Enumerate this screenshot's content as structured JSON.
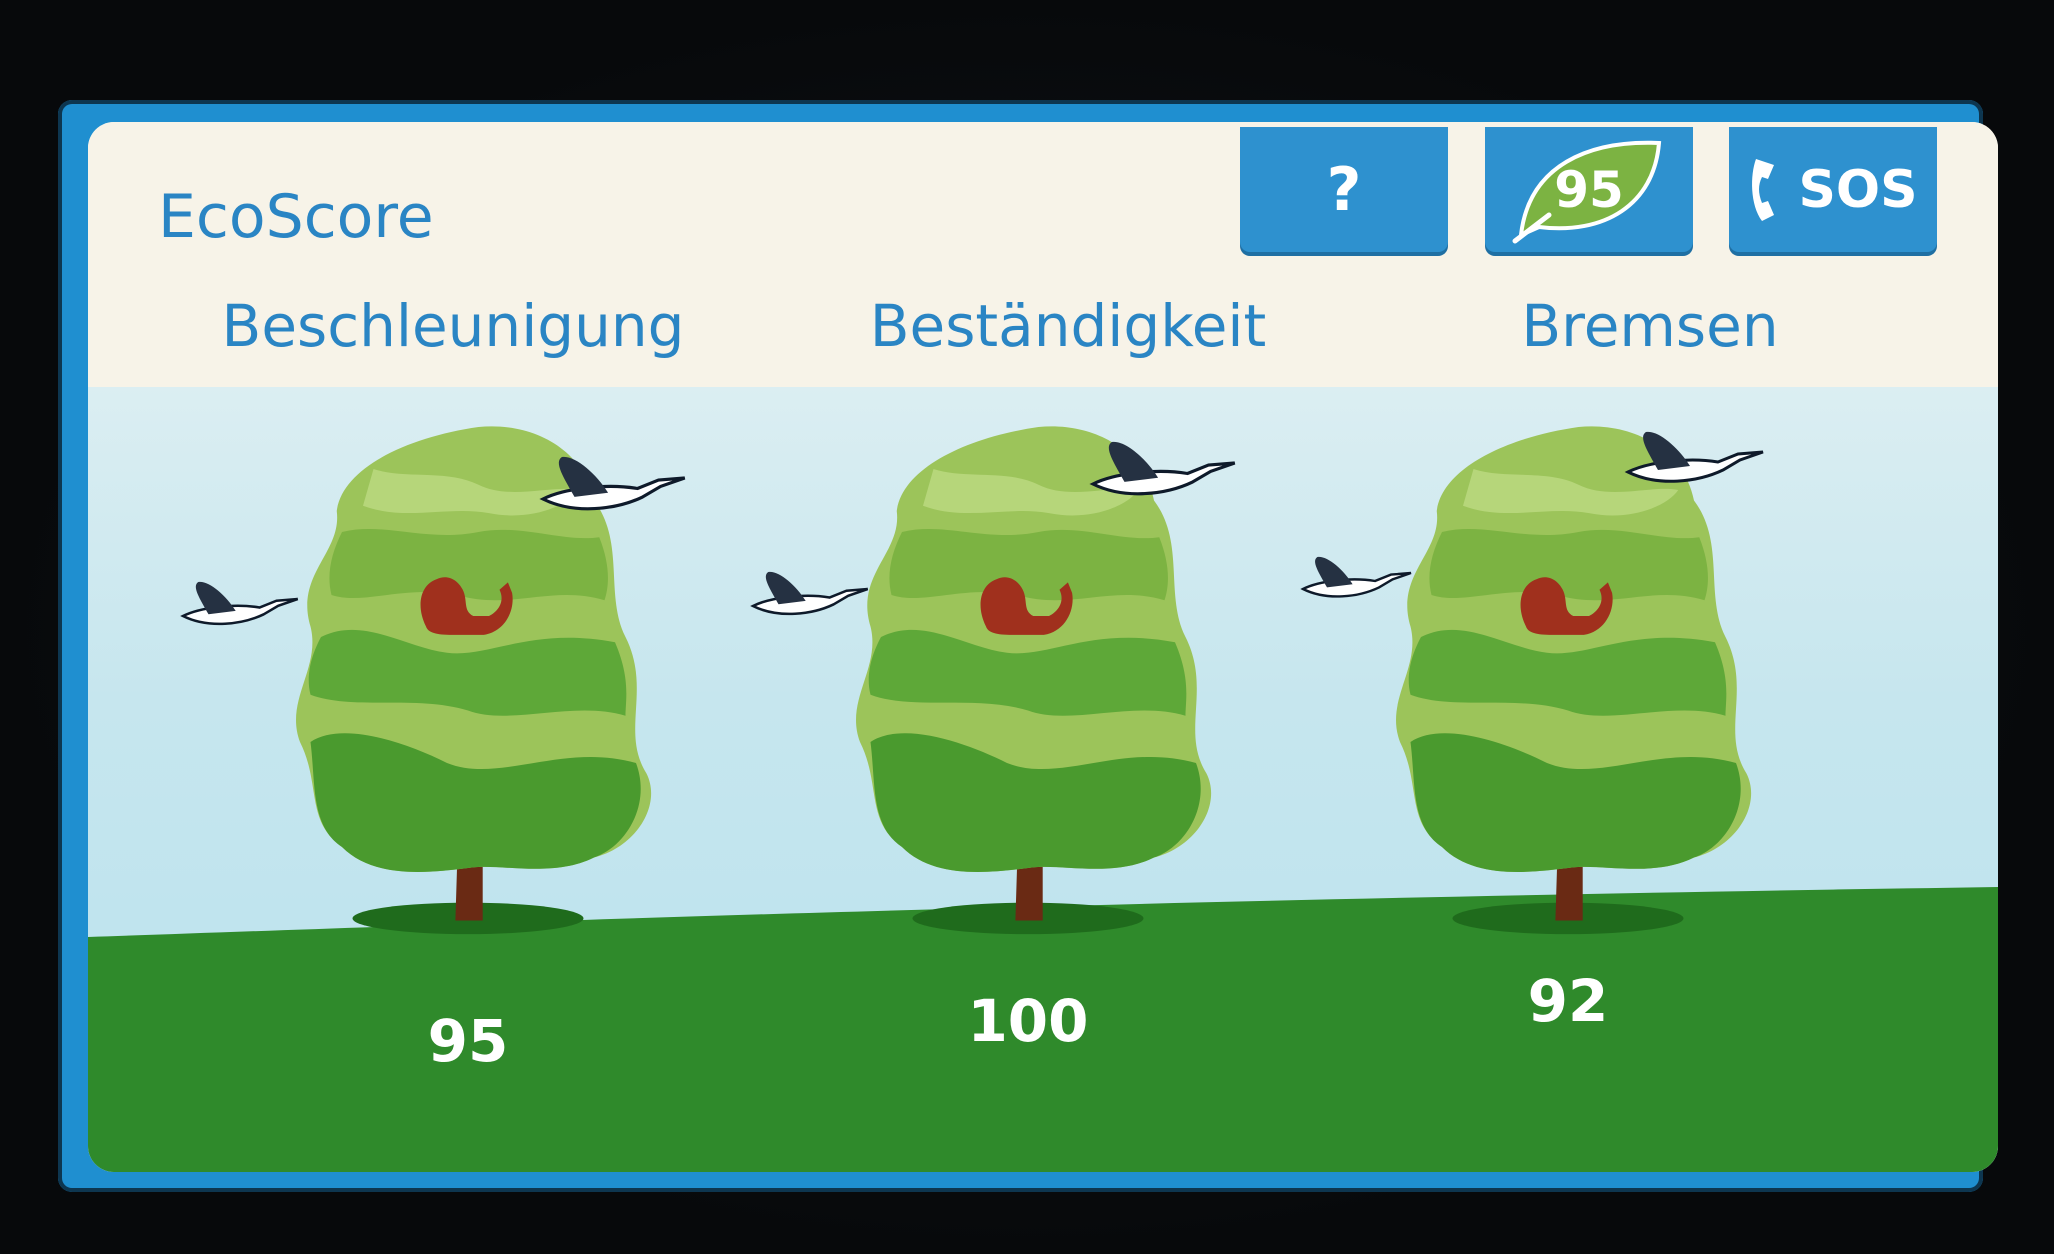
{
  "app": {
    "title": "EcoScore"
  },
  "toolbar": {
    "help_label": "?",
    "eco_score_value": "95",
    "sos_label": "SOS"
  },
  "categories": [
    {
      "label": "Beschleunigung",
      "score": "95"
    },
    {
      "label": "Beständigkeit",
      "score": "100"
    },
    {
      "label": "Bremsen",
      "score": "92"
    }
  ],
  "colors": {
    "accent_blue": "#2a85c4",
    "button_blue": "#2e91cf",
    "leaf_green": "#7cb342",
    "ground_green": "#2f8a2b",
    "sky": "#c6e6ee",
    "squirrel": "#a0301d"
  },
  "icons": {
    "help": "question-mark-icon",
    "eco": "leaf-icon",
    "sos": "phone-icon"
  }
}
